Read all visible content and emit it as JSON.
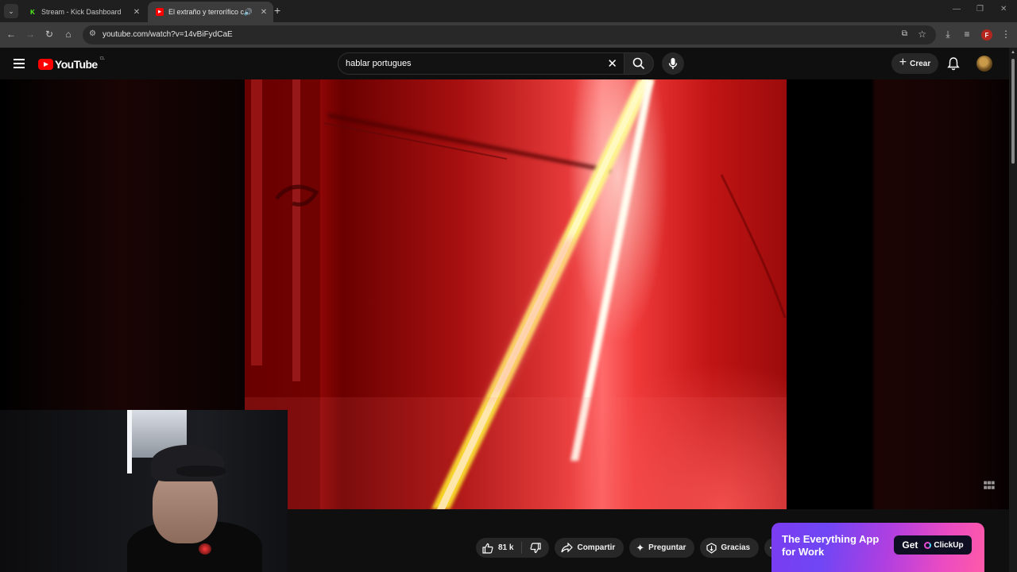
{
  "browser": {
    "tabs": [
      {
        "title": "Stream - Kick Dashboard",
        "favicon": "kick-icon",
        "active": false
      },
      {
        "title": "El extraño y terrorífico caso",
        "favicon": "youtube-icon",
        "active": true,
        "audio": true
      }
    ],
    "url": "youtube.com/watch?v=14vBiFydCaE",
    "profile_initial": "F"
  },
  "youtube": {
    "logo_text": "YouTube",
    "country_code": "CL",
    "search_query": "hablar portugues",
    "create_label": "Crear"
  },
  "actions": {
    "like_count": "81 k",
    "share_label": "Compartir",
    "ask_label": "Preguntar",
    "thanks_label": "Gracias"
  },
  "ad": {
    "headline": "The Everything App for Work",
    "cta_get": "Get",
    "brand": "ClickUp"
  },
  "colors": {
    "youtube_red": "#ff0000",
    "kick_green": "#53fc18",
    "ad_purple": "#7b3cf0",
    "ad_pink": "#ff5aa8"
  }
}
